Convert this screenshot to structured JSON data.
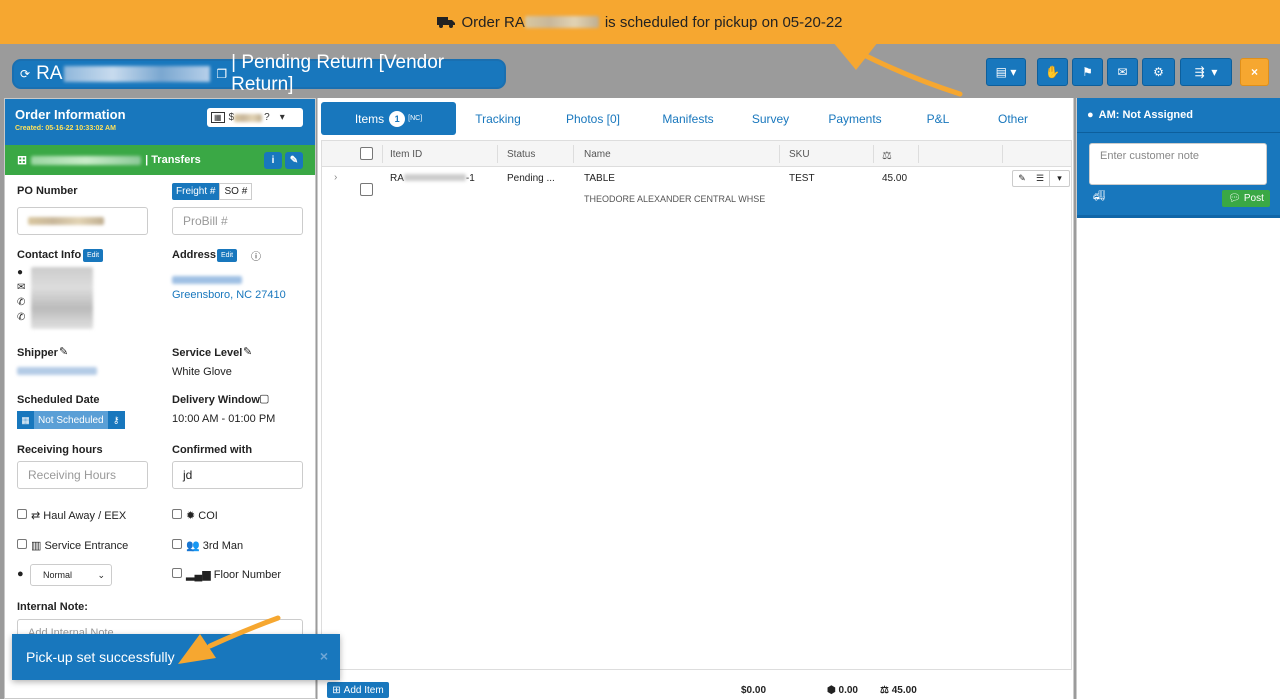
{
  "banner": {
    "prefix": "Order RA",
    "suffix": "is scheduled for pickup on",
    "date": "05-20-22"
  },
  "header": {
    "title_prefix": "RA",
    "title_status": "| Pending Return [Vendor Return]",
    "close_label": "×"
  },
  "order_info": {
    "title": "Order Information",
    "created": "Created: 05-16-22 10:33:02 AM",
    "currency_prefix": "$",
    "transfer_label": "| Transfers",
    "po_number_label": "PO Number",
    "freight_label": "Freight #",
    "so_label": "SO #",
    "probill_placeholder": "ProBill #",
    "contact_label": "Contact Info",
    "edit_label": "Edit",
    "address_label": "Address",
    "address_city": "Greensboro, NC 27410",
    "shipper_label": "Shipper",
    "service_level_label": "Service Level",
    "service_level_value": "White Glove",
    "scheduled_date_label": "Scheduled Date",
    "not_scheduled": "Not Scheduled",
    "delivery_window_label": "Delivery Window",
    "delivery_window_value": "10:00 AM - 01:00 PM",
    "receiving_label": "Receiving hours",
    "receiving_placeholder": "Receiving Hours",
    "confirmed_label": "Confirmed with",
    "confirmed_value": "jd",
    "haul_away": "Haul Away / EEX",
    "coi": "COI",
    "service_entrance": "Service Entrance",
    "third_man": "3rd Man",
    "priority_value": "Normal",
    "floor_number": "Floor Number",
    "internal_note_label": "Internal Note:",
    "internal_note_placeholder": "Add Internal Note"
  },
  "tabs": [
    {
      "label": "Items",
      "badge": "1",
      "sup": "[NC]"
    },
    {
      "label": "Tracking"
    },
    {
      "label": "Photos [0]"
    },
    {
      "label": "Manifests"
    },
    {
      "label": "Survey"
    },
    {
      "label": "Payments"
    },
    {
      "label": "P&L"
    },
    {
      "label": "Other"
    }
  ],
  "grid": {
    "headers": [
      "Item ID",
      "Status",
      "Name",
      "SKU"
    ],
    "rows": [
      {
        "item_id_prefix": "RA",
        "item_id_suffix": "-1",
        "status": "Pending ...",
        "name": "TABLE",
        "sub": "THEODORE ALEXANDER CENTRAL WHSE",
        "sku": "TEST",
        "weight": "45.00"
      }
    ]
  },
  "footer": {
    "add_item": "Add Item",
    "total_price": "$0.00",
    "total_cube": "0.00",
    "total_weight": "45.00"
  },
  "right": {
    "am_label": "AM: Not Assigned",
    "note_placeholder": "Enter customer note",
    "post_label": "Post"
  },
  "toast": {
    "message": "Pick-up set successfully",
    "close": "×"
  },
  "colors": {
    "brand_blue": "#1877bd",
    "orange": "#f6a730",
    "green": "#3aa845"
  }
}
